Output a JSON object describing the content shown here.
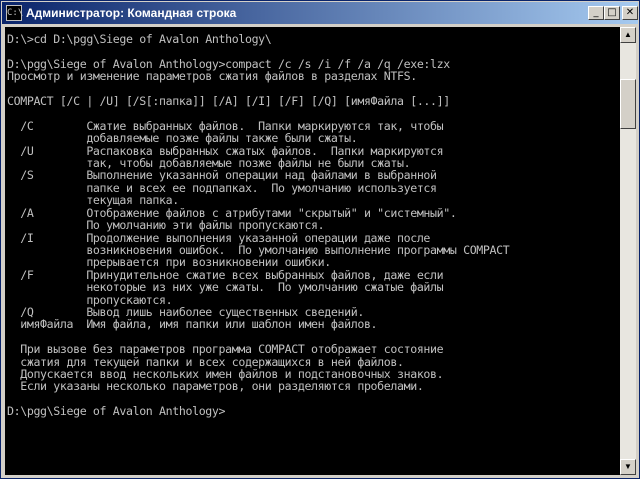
{
  "window": {
    "title": "Администратор: Командная строка",
    "icon_text": "C:\\",
    "buttons": {
      "minimize": "_",
      "maximize": "□",
      "close": "✕"
    }
  },
  "console": {
    "lines": [
      "D:\\>cd D:\\pgg\\Siege of Avalon Anthology\\",
      "",
      "D:\\pgg\\Siege of Avalon Anthology>compact /c /s /i /f /a /q /exe:lzx",
      "Просмотр и изменение параметров сжатия файлов в разделах NTFS.",
      "",
      "COMPACT [/C | /U] [/S[:папка]] [/A] [/I] [/F] [/Q] [имяФайла [...]]",
      "",
      "  /C        Сжатие выбранных файлов.  Папки маркируются так, чтобы",
      "            добавляемые позже файлы также были сжаты.",
      "  /U        Распаковка выбранных сжатых файлов.  Папки маркируются",
      "            так, чтобы добавляемые позже файлы не были сжаты.",
      "  /S        Выполнение указанной операции над файлами в выбранной",
      "            папке и всех ее подпапках.  По умолчанию используется",
      "            текущая папка.",
      "  /A        Отображение файлов с атрибутами \"скрытый\" и \"системный\".",
      "            По умолчанию эти файлы пропускаются.",
      "  /I        Продолжение выполнения указанной операции даже после",
      "            возникновения ошибок.  По умолчанию выполнение программы COMPACT",
      "            прерывается при возникновении ошибки.",
      "  /F        Принудительное сжатие всех выбранных файлов, даже если",
      "            некоторые из них уже сжаты.  По умолчанию сжатые файлы",
      "            пропускаются.",
      "  /Q        Вывод лишь наиболее существенных сведений.",
      "  имяФайла  Имя файла, имя папки или шаблон имен файлов.",
      "",
      "  При вызове без параметров программа COMPACT отображает состояние",
      "  сжатия для текущей папки и всех содержащихся в ней файлов.",
      "  Допускается ввод нескольких имен файлов и подстановочных знаков.",
      "  Если указаны несколько параметров, они разделяются пробелами.",
      "",
      "D:\\pgg\\Siege of Avalon Anthology>"
    ]
  },
  "scrollbar": {
    "up_arrow": "▲",
    "down_arrow": "▼"
  }
}
